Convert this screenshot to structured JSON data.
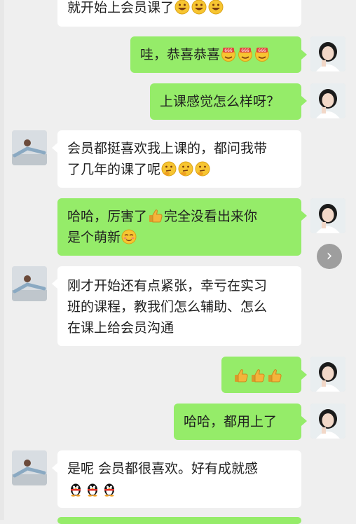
{
  "messages": [
    {
      "side": "left",
      "lines": [
        "就开始上会员课了"
      ],
      "emoji": "grin-icon",
      "emoji_count": 3
    },
    {
      "side": "right",
      "lines": [
        "哇，恭喜恭喜"
      ],
      "emoji": "666-face-icon",
      "emoji_count": 3
    },
    {
      "side": "right",
      "lines": [
        "上课感觉怎么样呀？"
      ]
    },
    {
      "side": "left",
      "lines": [
        "会员都挺喜欢我上课的，都问我带",
        "了几年的课了呢"
      ],
      "emoji": "thinking-icon",
      "emoji_count": 3
    },
    {
      "side": "right",
      "lines": [
        "哈哈，厉害了",
        "完全没看出来你",
        "是个萌新"
      ]
    },
    {
      "side": "left",
      "lines": [
        "刚才开始还有点紧张，幸亏在实习",
        "班的课程，教我们怎么辅助、怎么",
        "在课上给会员沟通"
      ]
    },
    {
      "side": "right",
      "lines": [],
      "emoji": "thumbs-up-icon",
      "emoji_count": 3
    },
    {
      "side": "right",
      "lines": [
        "哈哈，都用上了"
      ]
    },
    {
      "side": "left",
      "lines": [
        "是呢  会员都很喜欢。好有成就感"
      ],
      "emoji": "penguin-icon",
      "emoji_count": 3
    }
  ],
  "next_button_glyph": "›",
  "colors": {
    "bubble_green": "#95ec69",
    "bubble_white": "#ffffff",
    "background": "#efefef"
  }
}
